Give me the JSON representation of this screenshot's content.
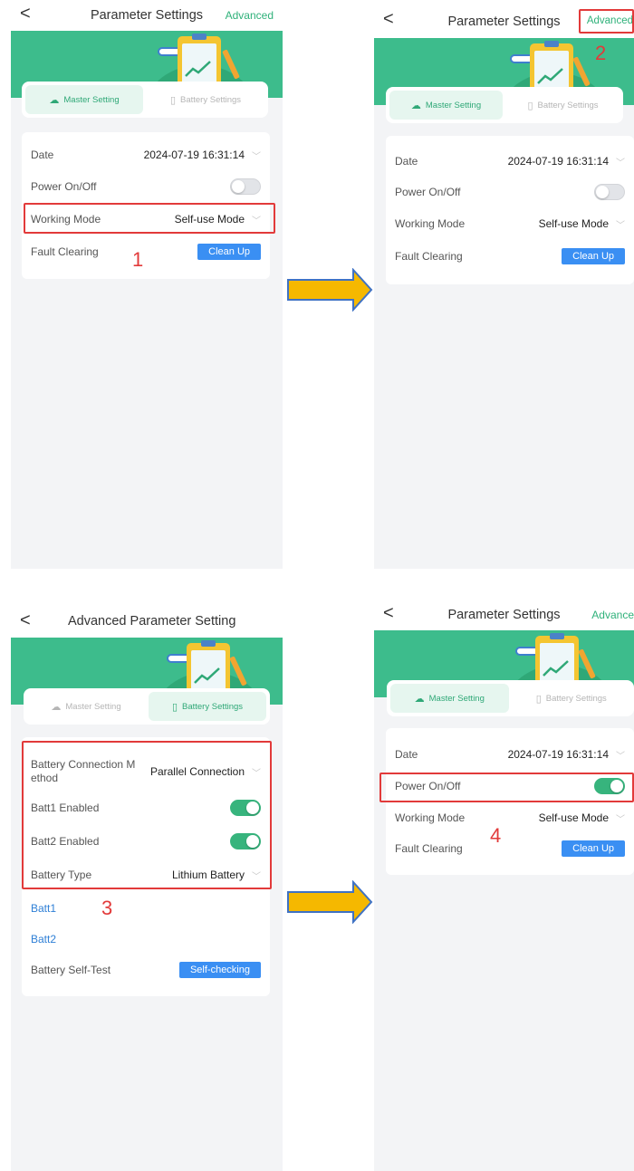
{
  "panels": {
    "p1": {
      "nav": {
        "back": "<",
        "title": "Parameter Settings",
        "advanced": "Advanced"
      },
      "tabs": {
        "master": "Master Setting",
        "battery": "Battery Settings"
      },
      "rows": {
        "date_label": "Date",
        "date_value": "2024-07-19 16:31:14",
        "power_label": "Power On/Off",
        "power_state": "off",
        "mode_label": "Working Mode",
        "mode_value": "Self-use Mode",
        "fault_label": "Fault Clearing",
        "fault_button": "Clean Up"
      },
      "step": "1"
    },
    "p2": {
      "nav": {
        "back": "<",
        "title": "Parameter Settings",
        "advanced": "Advanced"
      },
      "tabs": {
        "master": "Master Setting",
        "battery": "Battery Settings"
      },
      "rows": {
        "date_label": "Date",
        "date_value": "2024-07-19 16:31:14",
        "power_label": "Power On/Off",
        "power_state": "off",
        "mode_label": "Working Mode",
        "mode_value": "Self-use Mode",
        "fault_label": "Fault Clearing",
        "fault_button": "Clean Up"
      },
      "step": "2"
    },
    "p3": {
      "nav": {
        "back": "<",
        "title": "Advanced Parameter Setting"
      },
      "tabs": {
        "master": "Master Setting",
        "battery": "Battery Settings"
      },
      "rows": {
        "conn_label_1": "Battery Connection M",
        "conn_label_2": "ethod",
        "conn_value": "Parallel Connection",
        "batt1_label": "Batt1 Enabled",
        "batt1_state": "on",
        "batt2_label": "Batt2 Enabled",
        "batt2_state": "on",
        "type_label": "Battery Type",
        "type_value": "Lithium Battery",
        "batt1_link": "Batt1",
        "batt2_link": "Batt2",
        "selftest_label": "Battery Self-Test",
        "selftest_button": "Self-checking"
      },
      "step": "3"
    },
    "p4": {
      "nav": {
        "back": "<",
        "title": "Parameter Settings",
        "advanced": "Advance"
      },
      "tabs": {
        "master": "Master Setting",
        "battery": "Battery Settings"
      },
      "rows": {
        "date_label": "Date",
        "date_value": "2024-07-19 16:31:14",
        "power_label": "Power On/Off",
        "power_state": "on",
        "mode_label": "Working Mode",
        "mode_value": "Self-use Mode",
        "fault_label": "Fault Clearing",
        "fault_button": "Clean Up"
      },
      "step": "4"
    }
  },
  "colors": {
    "accent_green": "#2fb17a",
    "banner_green": "#3dbc8c",
    "button_blue": "#3a8ff3",
    "highlight_red": "#e23a3a",
    "arrow_fill": "#f5b800",
    "arrow_stroke": "#3f72c4"
  },
  "icons": {
    "back": "back-arrow-icon",
    "chevron": "chevron-down-icon",
    "master_tab": "cloud-icon",
    "battery_tab": "battery-icon",
    "flow_arrow": "arrow-right-icon"
  }
}
